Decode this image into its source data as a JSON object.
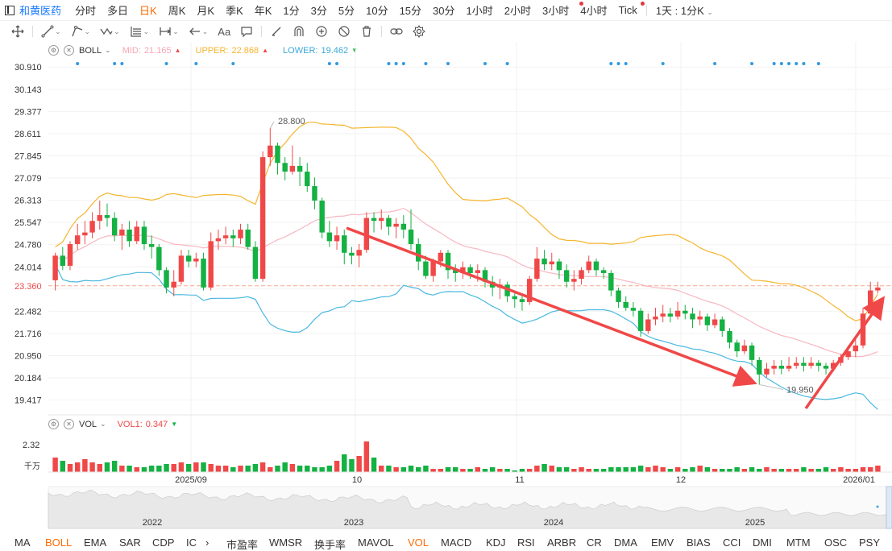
{
  "stock_name": "和黄医药",
  "periods": [
    {
      "label": "分时",
      "active": false
    },
    {
      "label": "多日",
      "active": false
    },
    {
      "label": "日K",
      "active": true
    },
    {
      "label": "周K",
      "active": false
    },
    {
      "label": "月K",
      "active": false
    },
    {
      "label": "季K",
      "active": false
    },
    {
      "label": "年K",
      "active": false
    },
    {
      "label": "1分",
      "active": false
    },
    {
      "label": "3分",
      "active": false
    },
    {
      "label": "5分",
      "active": false
    },
    {
      "label": "10分",
      "active": false
    },
    {
      "label": "15分",
      "active": false
    },
    {
      "label": "30分",
      "active": false
    },
    {
      "label": "1小时",
      "active": false
    },
    {
      "label": "2小时",
      "active": false
    },
    {
      "label": "3小时",
      "active": false
    },
    {
      "label": "4小时",
      "active": false
    },
    {
      "label": "Tick",
      "active": false
    }
  ],
  "period_dropdown": "1天 : 1分K",
  "toolbar": {
    "text_tool": "Aa"
  },
  "boll": {
    "name": "BOLL",
    "mid_label": "MID:",
    "mid_value": "21.165",
    "upper_label": "UPPER:",
    "upper_value": "22.868",
    "lower_label": "LOWER:",
    "lower_value": "19.462"
  },
  "vol": {
    "name": "VOL",
    "vol1_label": "VOL1:",
    "vol1_value": "0.347",
    "y_max_label": "2.32",
    "unit_label": "千万"
  },
  "colors": {
    "up": "#f04848",
    "down": "#14b143",
    "mid": "#f7b7c1",
    "upper": "#f5b52e",
    "lower": "#4ab8e0",
    "accent": "#ff6a00",
    "link": "#1677ff"
  },
  "chart_data": {
    "type": "candlestick",
    "y_ticks": [
      "30.910",
      "30.143",
      "29.377",
      "28.611",
      "27.845",
      "27.079",
      "26.313",
      "25.547",
      "24.780",
      "24.014",
      "23.248",
      "22.482",
      "21.716",
      "20.950",
      "20.184",
      "19.417"
    ],
    "ylim": [
      19.1,
      31.0
    ],
    "current_price_label": "23.360",
    "current_price": 23.36,
    "high_annotation": "28.800",
    "low_annotation": "19.950",
    "x_labels": [
      "2025/09",
      "10",
      "11",
      "12",
      "2026/01"
    ],
    "candles": [
      [
        23.55,
        24.4,
        24.5,
        23.2
      ],
      [
        24.4,
        24.05,
        24.7,
        23.9
      ],
      [
        24.05,
        24.8,
        24.9,
        23.9
      ],
      [
        24.8,
        25.1,
        25.5,
        24.6
      ],
      [
        25.1,
        25.2,
        25.6,
        24.8
      ],
      [
        25.2,
        25.6,
        25.9,
        25.0
      ],
      [
        25.6,
        25.8,
        26.3,
        25.3
      ],
      [
        25.8,
        25.7,
        26.2,
        25.4
      ],
      [
        25.7,
        25.1,
        25.9,
        24.9
      ],
      [
        25.1,
        25.3,
        25.5,
        24.6
      ],
      [
        25.3,
        24.9,
        25.6,
        24.7
      ],
      [
        24.9,
        25.4,
        25.6,
        24.8
      ],
      [
        25.4,
        24.8,
        25.6,
        24.6
      ],
      [
        24.8,
        24.7,
        25.1,
        24.3
      ],
      [
        24.7,
        23.9,
        24.8,
        23.7
      ],
      [
        23.9,
        23.3,
        24.0,
        23.1
      ],
      [
        23.3,
        23.5,
        23.9,
        23.0
      ],
      [
        23.5,
        24.4,
        24.6,
        23.4
      ],
      [
        24.4,
        24.2,
        24.6,
        24.0
      ],
      [
        24.2,
        24.3,
        24.5,
        24.0
      ],
      [
        24.3,
        23.3,
        24.5,
        23.2
      ],
      [
        23.3,
        24.9,
        25.2,
        23.2
      ],
      [
        24.9,
        25.0,
        25.3,
        24.6
      ],
      [
        25.0,
        25.1,
        25.4,
        24.8
      ],
      [
        25.1,
        25.0,
        25.3,
        24.7
      ],
      [
        25.0,
        25.3,
        25.5,
        24.8
      ],
      [
        25.3,
        24.7,
        25.5,
        24.6
      ],
      [
        24.7,
        23.6,
        24.9,
        23.5
      ],
      [
        23.6,
        27.8,
        28.0,
        23.5
      ],
      [
        27.8,
        28.2,
        28.8,
        27.5
      ],
      [
        28.2,
        27.6,
        28.3,
        27.2
      ],
      [
        27.6,
        27.3,
        27.8,
        27.0
      ],
      [
        27.3,
        27.5,
        28.2,
        27.2
      ],
      [
        27.5,
        27.3,
        27.8,
        26.8
      ],
      [
        27.3,
        26.8,
        27.6,
        26.6
      ],
      [
        26.8,
        26.3,
        27.1,
        26.0
      ],
      [
        26.3,
        25.2,
        26.4,
        25.0
      ],
      [
        25.2,
        24.9,
        25.6,
        24.7
      ],
      [
        24.9,
        25.1,
        25.4,
        24.6
      ],
      [
        25.1,
        24.5,
        25.3,
        24.1
      ],
      [
        24.5,
        24.4,
        24.7,
        24.1
      ],
      [
        24.4,
        24.6,
        24.8,
        24.0
      ],
      [
        24.6,
        25.7,
        25.9,
        24.5
      ],
      [
        25.7,
        25.6,
        25.9,
        25.2
      ],
      [
        25.6,
        25.7,
        26.0,
        25.3
      ],
      [
        25.7,
        25.4,
        25.8,
        25.1
      ],
      [
        25.4,
        25.5,
        25.7,
        25.0
      ],
      [
        25.5,
        25.3,
        25.8,
        25.0
      ],
      [
        25.3,
        24.8,
        26.0,
        24.6
      ],
      [
        24.8,
        24.2,
        25.0,
        23.9
      ],
      [
        24.2,
        23.7,
        24.4,
        23.6
      ],
      [
        23.7,
        24.2,
        24.3,
        23.5
      ],
      [
        24.2,
        24.5,
        24.6,
        24.0
      ],
      [
        24.5,
        23.9,
        24.6,
        23.6
      ],
      [
        23.9,
        23.8,
        24.1,
        23.5
      ],
      [
        23.8,
        24.0,
        24.2,
        23.6
      ],
      [
        24.0,
        23.8,
        24.1,
        23.6
      ],
      [
        23.8,
        23.9,
        24.1,
        23.5
      ],
      [
        23.9,
        23.5,
        24.0,
        23.3
      ],
      [
        23.5,
        23.3,
        23.7,
        23.0
      ],
      [
        23.3,
        23.4,
        23.6,
        22.9
      ],
      [
        23.4,
        23.0,
        23.5,
        22.8
      ],
      [
        23.0,
        22.9,
        23.1,
        22.6
      ],
      [
        22.9,
        22.8,
        23.1,
        22.5
      ],
      [
        22.8,
        23.6,
        23.7,
        22.7
      ],
      [
        23.6,
        24.3,
        24.7,
        23.5
      ],
      [
        24.3,
        24.1,
        24.6,
        23.9
      ],
      [
        24.1,
        24.2,
        24.5,
        23.9
      ],
      [
        24.2,
        23.9,
        24.3,
        23.6
      ],
      [
        23.9,
        23.5,
        24.1,
        23.3
      ],
      [
        23.5,
        23.6,
        23.9,
        23.2
      ],
      [
        23.6,
        23.9,
        24.0,
        23.4
      ],
      [
        23.9,
        24.2,
        24.4,
        23.8
      ],
      [
        24.2,
        23.9,
        24.3,
        23.7
      ],
      [
        23.9,
        23.8,
        24.0,
        23.6
      ],
      [
        23.8,
        23.2,
        23.9,
        23.0
      ],
      [
        23.2,
        22.8,
        23.3,
        22.6
      ],
      [
        22.8,
        22.6,
        23.0,
        22.5
      ],
      [
        22.6,
        22.5,
        22.8,
        22.3
      ],
      [
        22.5,
        21.8,
        22.6,
        21.6
      ],
      [
        21.8,
        22.2,
        22.4,
        21.7
      ],
      [
        22.2,
        22.3,
        22.6,
        22.0
      ],
      [
        22.3,
        22.4,
        22.7,
        22.1
      ],
      [
        22.4,
        22.3,
        22.6,
        22.1
      ],
      [
        22.3,
        22.5,
        22.8,
        22.2
      ],
      [
        22.5,
        22.4,
        22.7,
        22.2
      ],
      [
        22.4,
        22.2,
        22.6,
        21.9
      ],
      [
        22.2,
        22.3,
        22.5,
        22.0
      ],
      [
        22.3,
        22.0,
        22.4,
        21.8
      ],
      [
        22.0,
        22.2,
        22.4,
        21.9
      ],
      [
        22.2,
        21.8,
        22.3,
        21.6
      ],
      [
        21.8,
        21.4,
        21.9,
        21.2
      ],
      [
        21.4,
        21.1,
        21.5,
        20.9
      ],
      [
        21.1,
        21.3,
        21.5,
        21.0
      ],
      [
        21.3,
        20.8,
        21.4,
        20.6
      ],
      [
        20.8,
        20.3,
        20.9,
        19.95
      ],
      [
        20.3,
        20.5,
        20.7,
        20.2
      ],
      [
        20.5,
        20.6,
        20.8,
        20.3
      ],
      [
        20.6,
        20.5,
        20.8,
        20.3
      ],
      [
        20.5,
        20.6,
        20.9,
        20.4
      ],
      [
        20.6,
        20.7,
        20.9,
        20.5
      ],
      [
        20.7,
        20.6,
        20.9,
        20.4
      ],
      [
        20.6,
        20.7,
        20.9,
        20.5
      ],
      [
        20.7,
        20.6,
        20.8,
        20.4
      ],
      [
        20.6,
        20.5,
        20.7,
        20.3
      ],
      [
        20.5,
        20.7,
        20.8,
        20.4
      ],
      [
        20.7,
        20.9,
        21.0,
        20.6
      ],
      [
        20.9,
        21.1,
        21.3,
        20.8
      ],
      [
        21.1,
        21.3,
        21.5,
        20.9
      ],
      [
        21.3,
        22.4,
        22.6,
        21.2
      ],
      [
        22.4,
        23.2,
        23.5,
        22.3
      ],
      [
        23.2,
        23.3,
        23.5,
        23.1
      ]
    ],
    "mid": [
      24.14,
      23.95,
      23.8,
      23.7,
      23.55,
      23.4,
      23.35
    ],
    "vol_values": [
      0.9,
      0.7,
      0.5,
      0.6,
      0.8,
      0.6,
      0.5,
      0.6,
      0.7,
      0.4,
      0.4,
      0.3,
      0.3,
      0.4,
      0.4,
      0.5,
      0.5,
      0.6,
      0.5,
      0.6,
      0.6,
      0.5,
      0.4,
      0.4,
      0.3,
      0.4,
      0.4,
      0.5,
      0.6,
      0.3,
      0.4,
      0.6,
      0.5,
      0.4,
      0.4,
      0.3,
      0.3,
      0.4,
      0.7,
      1.1,
      0.8,
      1.0,
      1.9,
      0.9,
      0.4,
      0.4,
      0.3,
      0.3,
      0.4,
      0.3,
      0.4,
      0.2,
      0.2,
      0.3,
      0.3,
      0.2,
      0.2,
      0.3,
      0.2,
      0.3,
      0.2,
      0.2,
      0.1,
      0.2,
      0.2,
      0.4,
      0.5,
      0.4,
      0.3,
      0.3,
      0.2,
      0.3,
      0.2,
      0.2,
      0.2,
      0.3,
      0.3,
      0.3,
      0.3,
      0.4,
      0.3,
      0.4,
      0.3,
      0.2,
      0.3,
      0.2,
      0.3,
      0.4,
      0.3,
      0.2,
      0.2,
      0.2,
      0.3,
      0.2,
      0.3,
      0.2,
      0.3,
      0.2,
      0.2,
      0.2,
      0.2,
      0.3,
      0.2,
      0.2,
      0.3,
      0.2,
      0.3,
      0.2,
      0.2,
      0.3,
      0.3,
      0.4,
      0.3,
      0.5,
      0.4,
      0.8,
      0.3,
      0.6
    ],
    "navigator_labels": [
      "2022",
      "2023",
      "2024",
      "2025"
    ]
  },
  "indicator_tabs": [
    "MA",
    "BOLL",
    "EMA",
    "SAR",
    "CDP",
    "IC",
    "市盈率",
    "WMSR",
    "换手率",
    "MAVOL",
    "VOL",
    "MACD",
    "KDJ",
    "RSI",
    "ARBR",
    "CR",
    "DMA",
    "EMV",
    "BIAS",
    "CCI",
    "DMI",
    "MTM",
    "OSC",
    "PSY"
  ],
  "active_indicator_tabs": [
    "BOLL",
    "VOL"
  ]
}
